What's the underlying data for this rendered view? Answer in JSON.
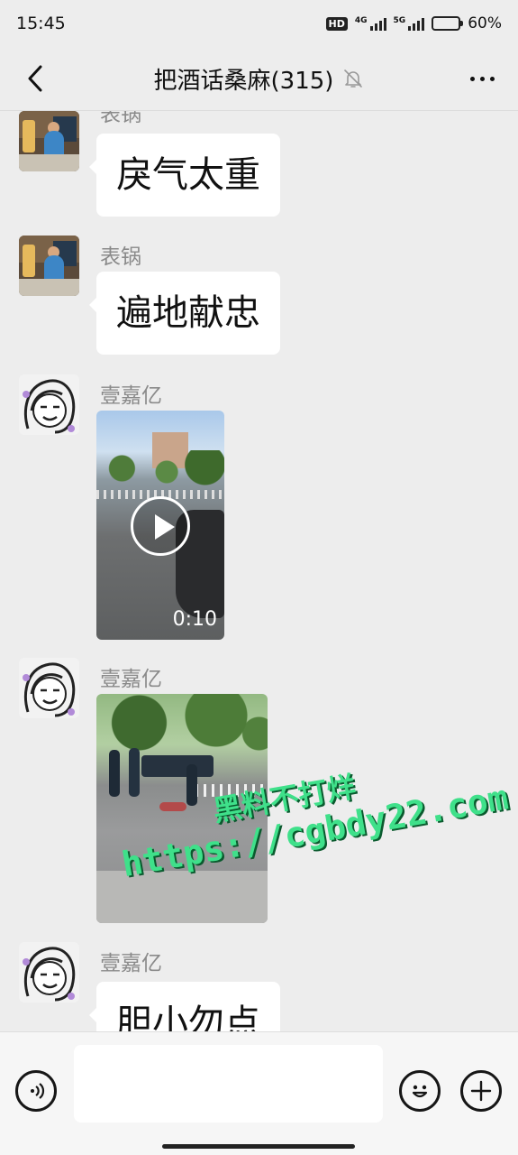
{
  "status_bar": {
    "time": "15:45",
    "hd_label": "HD",
    "net1": "4G",
    "net2": "5G",
    "battery_text": "60%",
    "battery_level": 0.6
  },
  "header": {
    "title": "把酒话桑麻(315)"
  },
  "messages": [
    {
      "sender": "表锅",
      "text": "戾气太重"
    },
    {
      "sender": "表锅",
      "text": "遍地献忠"
    },
    {
      "sender": "壹嘉亿",
      "type": "video",
      "duration": "0:10"
    },
    {
      "sender": "壹嘉亿",
      "type": "image"
    },
    {
      "sender": "壹嘉亿",
      "text": "胆小勿点"
    }
  ],
  "watermark": {
    "line1": "黑料不打烊",
    "line2": "https://cgbdy22.com"
  },
  "icons": {
    "back": "back-arrow-icon",
    "mute": "bell-muted-icon",
    "more": "more-dots-icon",
    "voice": "voice-icon",
    "emoji": "emoji-icon",
    "plus": "plus-icon"
  },
  "colors": {
    "background": "#ededed",
    "bubble": "#ffffff",
    "watermark": "#3fe08a"
  }
}
